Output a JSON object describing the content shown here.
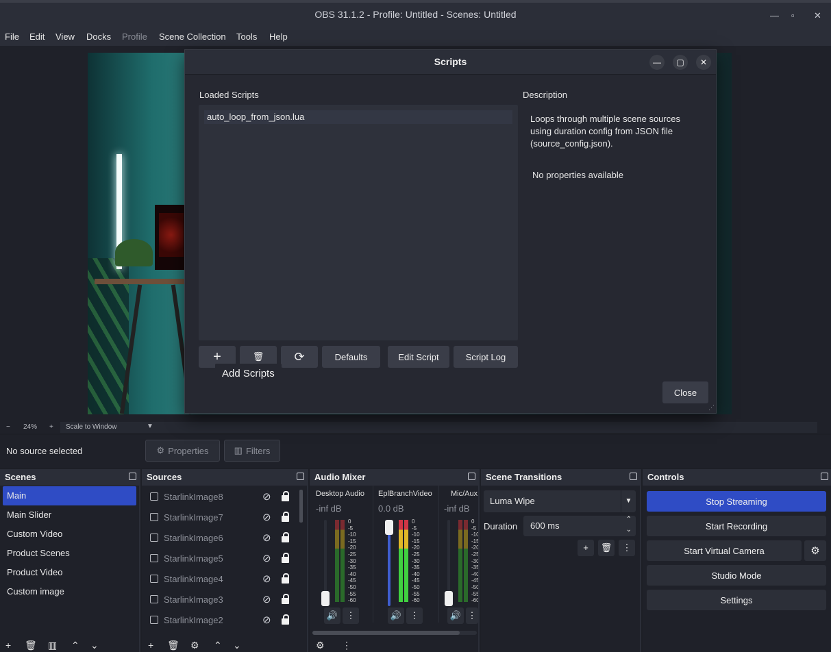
{
  "window": {
    "title": "OBS 31.1.2 - Profile: Untitled - Scenes: Untitled"
  },
  "menu": [
    "File",
    "Edit",
    "View",
    "Docks",
    "Profile",
    "Scene Collection",
    "Tools",
    "Help"
  ],
  "zoom": {
    "minus": "−",
    "level": "24%",
    "plus": "+",
    "mode": "Scale to Window"
  },
  "properties_bar": {
    "status": "No source selected",
    "properties_label": "Properties",
    "filters_label": "Filters"
  },
  "scripts_dialog": {
    "title": "Scripts",
    "loaded_label": "Loaded Scripts",
    "scripts": [
      "auto_loop_from_json.lua"
    ],
    "description_label": "Description",
    "description": "Loops through multiple scene sources using duration config from JSON file (source_config.json).",
    "no_props": "No properties available",
    "buttons": {
      "add": "+",
      "remove": "🗑",
      "reload": "⟳",
      "defaults": "Defaults",
      "edit": "Edit Script",
      "log": "Script Log",
      "close": "Close"
    },
    "tooltip": "Add Scripts"
  },
  "scenes": {
    "title": "Scenes",
    "items": [
      "Main",
      "Main Slider",
      "Custom Video",
      "Product Scenes",
      "Product Video",
      "Custom image"
    ],
    "selected": "Main"
  },
  "sources": {
    "title": "Sources",
    "items": [
      "StarlinkImage8",
      "StarlinkImage7",
      "StarlinkImage6",
      "StarlinkImage5",
      "StarlinkImage4",
      "StarlinkImage3",
      "StarlinkImage2"
    ]
  },
  "mixer": {
    "title": "Audio Mixer",
    "channels": [
      {
        "name": "Desktop Audio",
        "db": "-inf dB"
      },
      {
        "name": "EplBranchVideo",
        "db": "0.0 dB"
      },
      {
        "name": "Mic/Aux",
        "db": "-inf dB"
      }
    ],
    "scale": [
      "0",
      "-5",
      "-10",
      "-15",
      "-20",
      "-25",
      "-30",
      "-35",
      "-40",
      "-45",
      "-50",
      "-55",
      "-60"
    ]
  },
  "transitions": {
    "title": "Scene Transitions",
    "selected": "Luma Wipe",
    "duration_label": "Duration",
    "duration_value": "600 ms"
  },
  "controls": {
    "title": "Controls",
    "stop_streaming": "Stop Streaming",
    "start_recording": "Start Recording",
    "start_virtual_camera": "Start Virtual Camera",
    "studio_mode": "Studio Mode",
    "settings": "Settings"
  },
  "colors": {
    "accent": "#2f4cc5",
    "bg": "#1f2129",
    "panel": "#2b2e38"
  }
}
